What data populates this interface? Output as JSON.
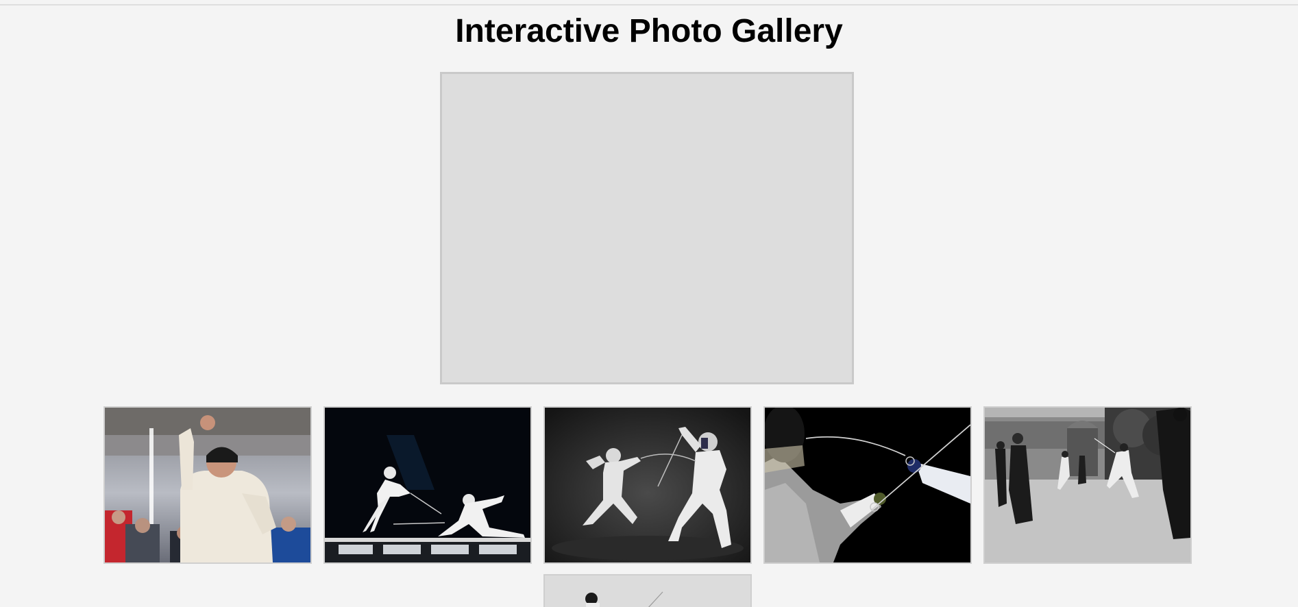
{
  "page": {
    "title": "Interactive Photo Gallery"
  },
  "viewer": {
    "background_color": "#dddddd",
    "border_color": "#c9c9c9"
  },
  "thumbnails": [
    {
      "subject": "fencer celebrating with raised fist"
    },
    {
      "subject": "two fencers lunging on dark piste"
    },
    {
      "subject": "two fencers in white on dark background"
    },
    {
      "subject": "close-up of crossed foils and gloved hands"
    },
    {
      "subject": "black and white historic duel in street"
    },
    {
      "subject": "fencer partially visible (cropped)"
    }
  ],
  "colors": {
    "page_background": "#f4f4f4",
    "title_color": "#000000",
    "thumb_border": "#cfcfcf"
  }
}
